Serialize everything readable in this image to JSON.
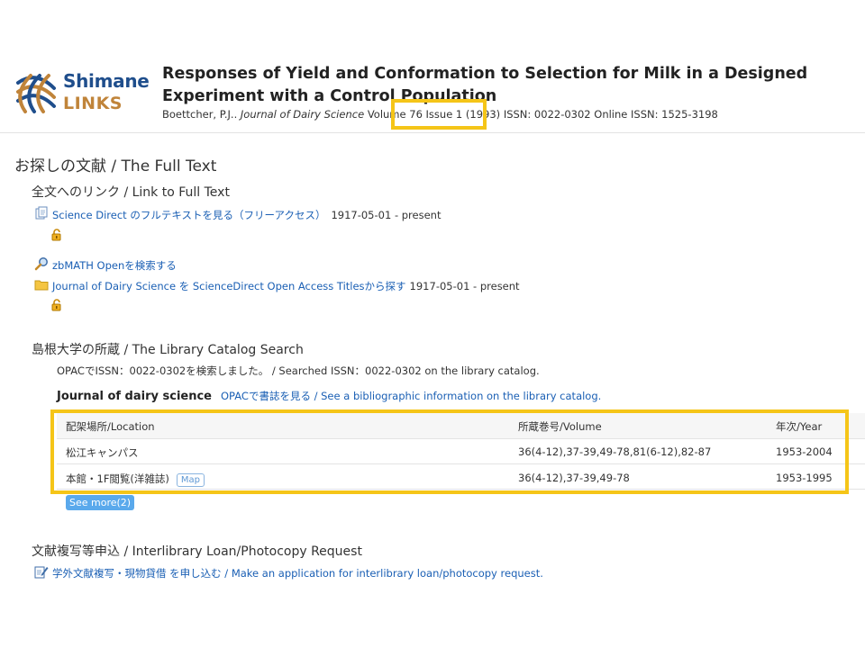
{
  "logo": {
    "line1": "Shimane",
    "line2": "LINKS",
    "colors": {
      "blue": "#1f4e8c",
      "gold": "#c0843a"
    }
  },
  "article": {
    "title": "Responses of Yield and Conformation to Selection for Milk in a Designed Experiment with a Control Population",
    "author": "Boettcher, P.J..",
    "journal": "Journal of Dairy Science",
    "volume_prefix": "Volume",
    "volume_issue": "76 Issue 1 (1993)",
    "issn": "ISSN: 0022-0302 Online ISSN: 1525-3198"
  },
  "section_fulltext": {
    "heading": "お探しの文献 / The Full Text",
    "links_heading": "全文へのリンク / Link to Full Text",
    "items": [
      {
        "icon": "document-icon",
        "label": "Science Direct のフルテキストを見る（フリーアクセス）",
        "coverage": "1917-05-01 - present",
        "open_access": true
      },
      {
        "icon": "magnifier-icon",
        "label": "zbMATH Openを検索する",
        "coverage": "",
        "open_access": false
      },
      {
        "icon": "folder-icon",
        "label": "Journal of Dairy Science を ScienceDirect Open Access Titlesから探す",
        "coverage": "1917-05-01 - present",
        "open_access": true
      }
    ]
  },
  "section_catalog": {
    "heading": "島根大学の所蔵 / The Library Catalog Search",
    "opac_note": "OPACでISSN：0022-0302を検索しました。 / Searched ISSN：0022-0302 on the library catalog.",
    "journal_title": "Journal of dairy science",
    "biblio_link": "OPACで書誌を見る / See a bibliographic information on the library catalog.",
    "table": {
      "headers": [
        "配架場所/Location",
        "所蔵巻号/Volume",
        "年次/Year"
      ],
      "rows": [
        {
          "location": "松江キャンパス",
          "volume": "36(4-12),37-39,49-78,81(6-12),82-87",
          "year": "1953-2004",
          "map": ""
        },
        {
          "location": "本館・1F閲覧(洋雑誌)",
          "volume": "36(4-12),37-39,49-78",
          "year": "1953-1995",
          "map": "Map"
        }
      ]
    },
    "see_more": "See more(2)"
  },
  "section_ill": {
    "heading": "文献複写等申込 / Interlibrary Loan/Photocopy Request",
    "link": "学外文献複写・現物貸借 を申し込む / Make an application for interlibrary loan/photocopy request."
  },
  "highlight_color": "#f5c518",
  "link_color": "#1a5fb4"
}
